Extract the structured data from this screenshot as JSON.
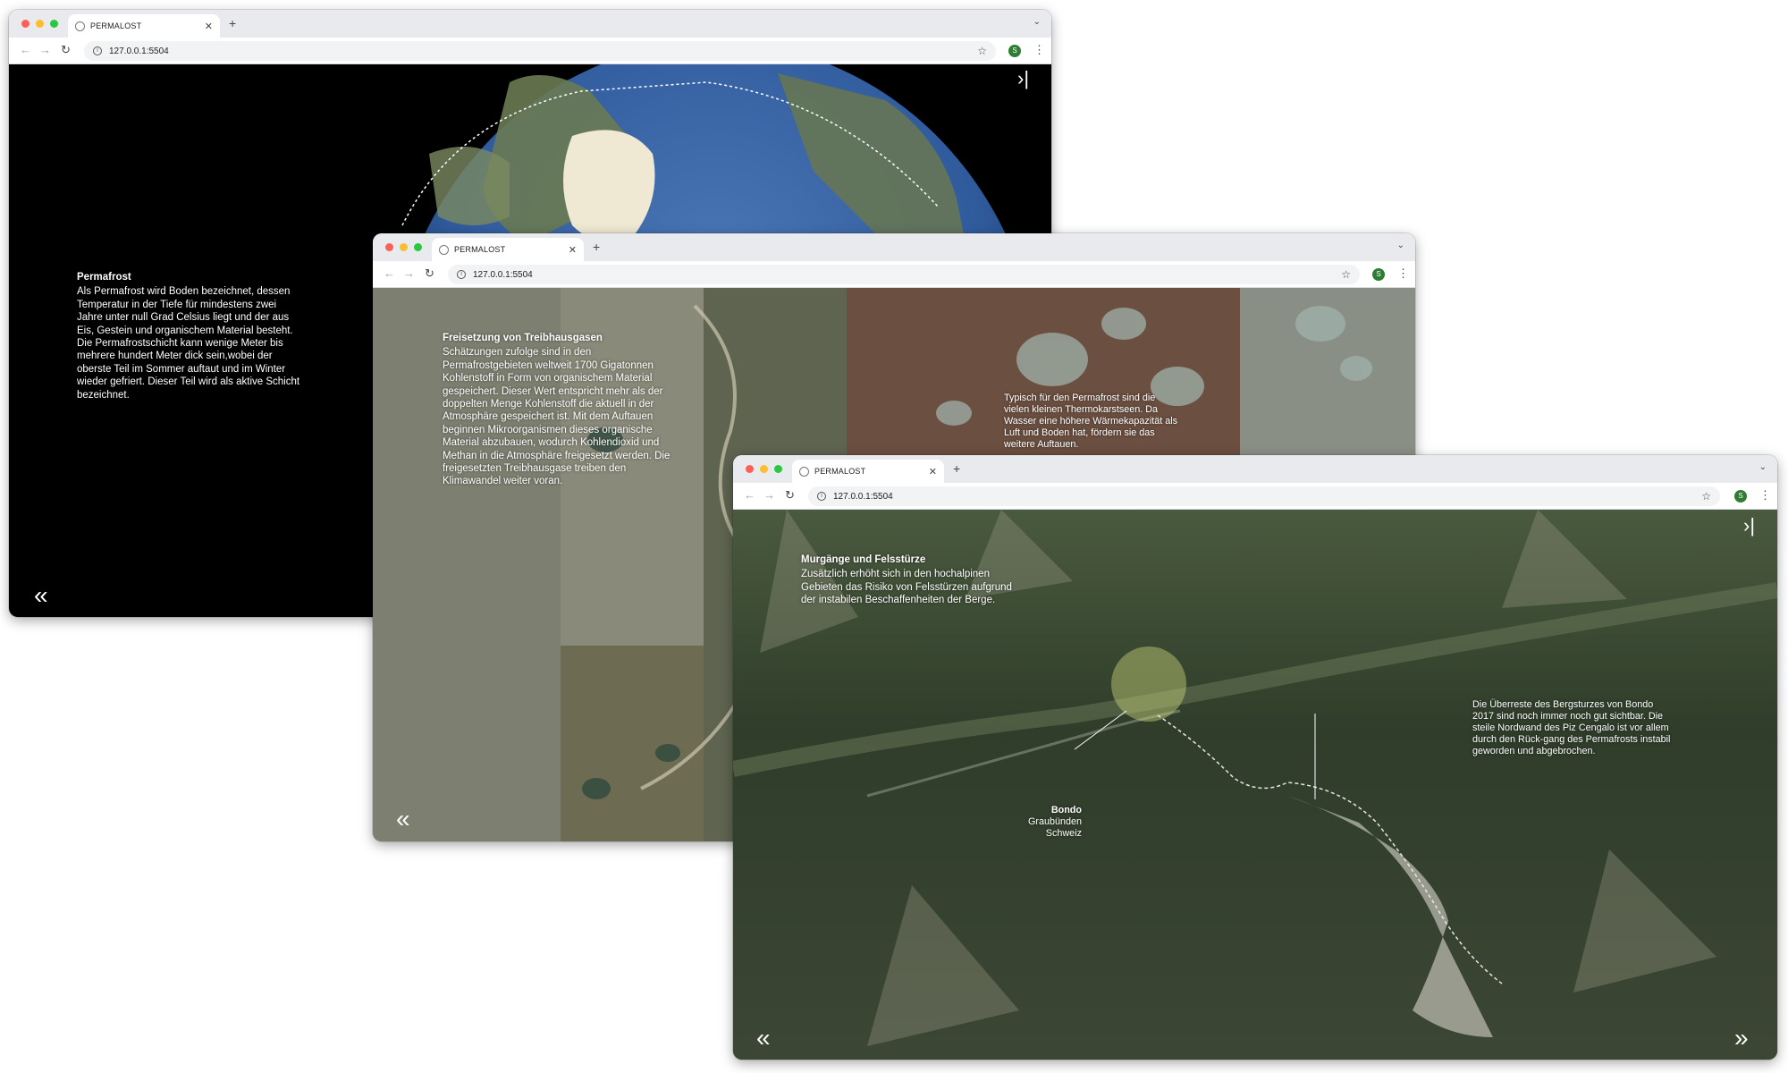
{
  "windows": [
    {
      "tab_title": "PERMALOST",
      "url": "127.0.0.1:5504",
      "profile_initial": "S",
      "heading": "Permafrost",
      "body": "Als Permafrost wird Boden bezeichnet, dessen Temperatur in der Tiefe für mindestens zwei Jahre unter null Grad Celsius liegt und der aus Eis, Gestein und organischem Material besteht. Die Permafrostschicht kann wenige Meter bis mehrere hundert Meter dick sein,wobei der oberste Teil im Sommer auftaut und im Winter wieder gefriert. Dieser Teil wird als aktive Schicht bezeichnet.",
      "nav_prev": "«",
      "nav_next": "›|"
    },
    {
      "tab_title": "PERMALOST",
      "url": "127.0.0.1:5504",
      "profile_initial": "S",
      "heading": "Freisetzung von Treibhausgasen",
      "body": "Schätzungen zufolge sind in den Permafrostgebieten weltweit 1700 Gigatonnen Kohlenstoff in Form von organischem Material gespeichert. Dieser Wert entspricht mehr als der doppelten Menge Kohlenstoff die aktuell in der Atmosphäre gespeichert ist. Mit dem Auftauen beginnen Mikroorganismen dieses organische Material abzubauen, wodurch Kohlendioxid und Methan in die Atmosphäre freigesetzt werden. Die freigesetzten Treibhausgase treiben den Klimawandel weiter voran.",
      "side_note": "Typisch für den Permafrost sind die vielen kleinen Thermokarstseen. Da Wasser eine höhere Wärmekapazität als Luft und Boden hat, fördern sie das weitere Auftauen.",
      "nav_prev": "«"
    },
    {
      "tab_title": "PERMALOST",
      "url": "127.0.0.1:5504",
      "profile_initial": "S",
      "heading": "Murgänge und Felsstürze",
      "body": "Zusätzlich erhöht sich in den hochalpinen Gebieten das Risiko von Felsstürzen aufgrund der instabilen Beschaffenheiten der Berge.",
      "side_note": "Die Überreste des Bergsturzes von Bondo 2017 sind noch immer noch gut sichtbar. Die steile Nordwand des Piz Cengalo ist vor allem durch den Rück-gang des Permafrosts instabil geworden und abgebrochen.",
      "location_name": "Bondo",
      "location_region": "Graubünden",
      "location_country": "Schweiz",
      "nav_prev": "«",
      "nav_next": "»",
      "nav_top": "›|"
    }
  ],
  "colors": {
    "glacier": "#efe8d2",
    "ocean": "#2f5a9c",
    "alpine": "#344230",
    "tundra": "#6f7560",
    "highlight": "#c9d27a"
  }
}
